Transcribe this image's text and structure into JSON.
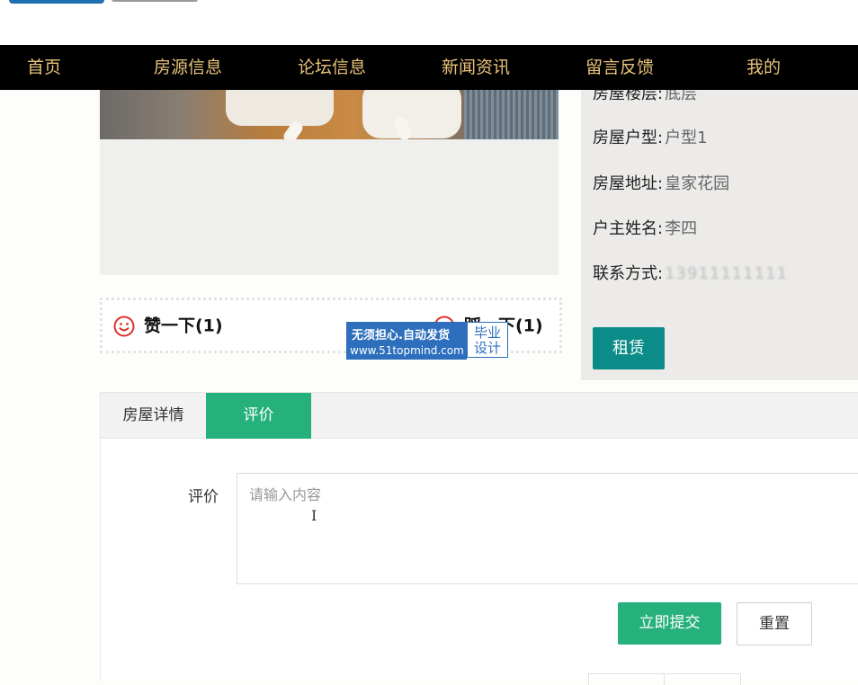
{
  "nav": {
    "items": [
      {
        "label": "首页"
      },
      {
        "label": "房源信息"
      },
      {
        "label": "论坛信息"
      },
      {
        "label": "新闻资讯"
      },
      {
        "label": "留言反馈"
      },
      {
        "label": "我的"
      }
    ]
  },
  "house_info": {
    "floor": {
      "label": "房屋楼层:",
      "value": "底层"
    },
    "layout": {
      "label": "房屋户型:",
      "value": "户型1"
    },
    "address": {
      "label": "房屋地址:",
      "value": "皇家花园"
    },
    "owner": {
      "label": "户主姓名:",
      "value": "李四"
    },
    "contact": {
      "label": "联系方式:",
      "value": "13911111111"
    },
    "rent_button": "租赁"
  },
  "votes": {
    "like": {
      "label": "赞一下(1)"
    },
    "dislike": {
      "label": "踩一下(1)"
    }
  },
  "watermark": {
    "line1": "无须担心.自动发货",
    "line2": "www.51topmind.com",
    "badge": "毕业设计"
  },
  "tabs": [
    {
      "label": "房屋详情",
      "active": false
    },
    {
      "label": "评价",
      "active": true
    }
  ],
  "review_form": {
    "label": "评价",
    "placeholder": "请输入内容",
    "value": "",
    "submit": "立即提交",
    "reset": "重置"
  },
  "colors": {
    "nav_bg": "#000000",
    "nav_text": "#e8c27a",
    "accent_green": "#25b07c",
    "rent_teal": "#0c8c88",
    "icon_red": "#e0312a",
    "watermark_blue": "#2d6fbd"
  }
}
